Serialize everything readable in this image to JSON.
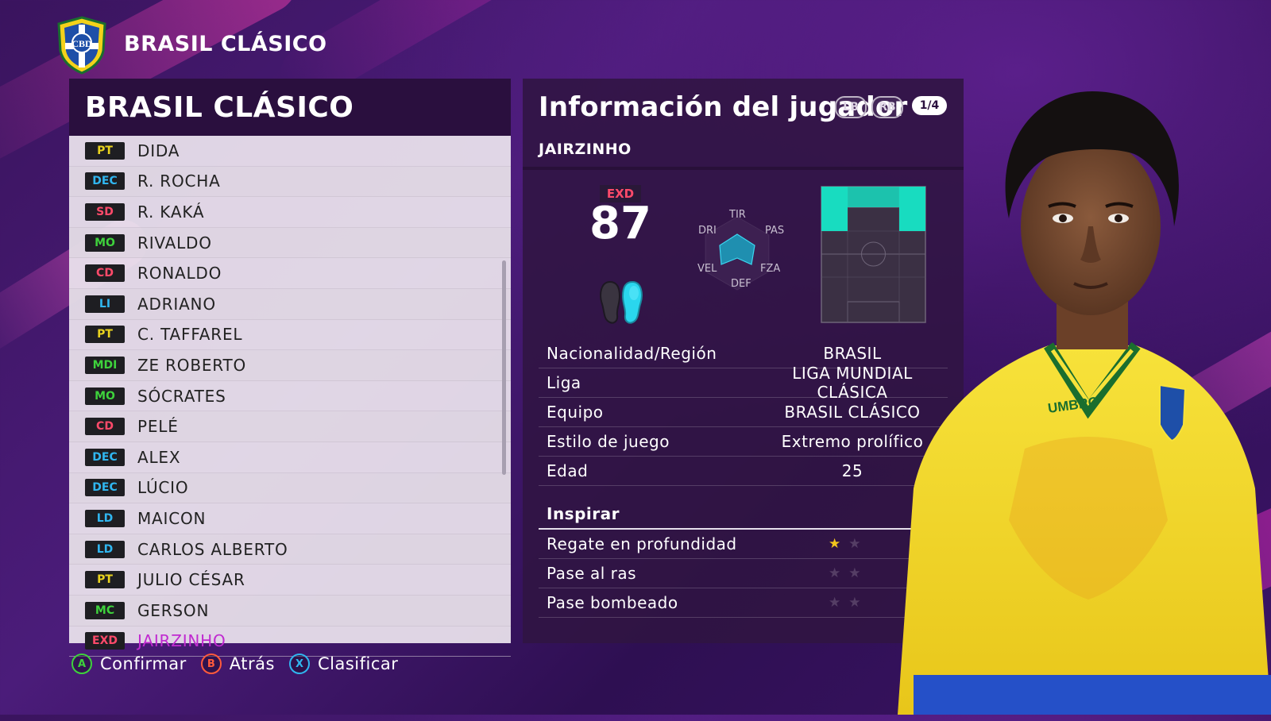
{
  "header": {
    "team_name": "BRASIL CLÁSICO",
    "crest_text": "CBD"
  },
  "roster": {
    "title": "BRASIL CLÁSICO",
    "players": [
      {
        "pos": "PT",
        "name": "DIDA"
      },
      {
        "pos": "DEC",
        "name": "R. ROCHA"
      },
      {
        "pos": "SD",
        "name": "R. KAKÁ"
      },
      {
        "pos": "MO",
        "name": "RIVALDO"
      },
      {
        "pos": "CD",
        "name": "RONALDO"
      },
      {
        "pos": "LI",
        "name": "ADRIANO"
      },
      {
        "pos": "PT",
        "name": "C. TAFFAREL"
      },
      {
        "pos": "MDI",
        "name": "ZE ROBERTO"
      },
      {
        "pos": "MO",
        "name": "SÓCRATES"
      },
      {
        "pos": "CD",
        "name": "PELÉ"
      },
      {
        "pos": "DEC",
        "name": "ALEX"
      },
      {
        "pos": "DEC",
        "name": "LÚCIO"
      },
      {
        "pos": "LD",
        "name": "MAICON"
      },
      {
        "pos": "LD",
        "name": "CARLOS ALBERTO"
      },
      {
        "pos": "PT",
        "name": "JULIO CÉSAR"
      },
      {
        "pos": "MC",
        "name": "GERSON"
      },
      {
        "pos": "EXD",
        "name": "JAIRZINHO"
      }
    ],
    "selected_index": 16
  },
  "buttons": [
    {
      "key": "A",
      "label": "Confirmar",
      "color": "#3ed23c"
    },
    {
      "key": "B",
      "label": "Atrás",
      "color": "#ff5a3c"
    },
    {
      "key": "X",
      "label": "Clasificar",
      "color": "#30b6f0"
    }
  ],
  "player_info": {
    "title": "Información del jugador",
    "lb": "LB",
    "rb": "RB",
    "page": "1/4",
    "name": "JAIRZINHO",
    "position": "EXD",
    "rating": "87",
    "radar_labels": {
      "tir": "TIR",
      "pas": "PAS",
      "fza": "FZA",
      "def": "DEF",
      "vel": "VEL",
      "dri": "DRI"
    },
    "details": [
      {
        "label": "Nacionalidad/Región",
        "value": "BRASIL"
      },
      {
        "label": "Liga",
        "value": "LIGA MUNDIAL CLÁSICA"
      },
      {
        "label": "Equipo",
        "value": "BRASIL CLÁSICO"
      },
      {
        "label": "Estilo de juego",
        "value": "Extremo prolífico"
      },
      {
        "label": "Edad",
        "value": "25"
      }
    ],
    "inspire": {
      "title": "Inspirar",
      "skills": [
        {
          "label": "Regate en profundidad",
          "stars": 1
        },
        {
          "label": "Pase al ras",
          "stars": 0
        },
        {
          "label": "Pase bombeado",
          "stars": 0
        }
      ]
    }
  },
  "colors": {
    "accent_selected": "#c02ad0",
    "gk": "#e8d21e",
    "def": "#30b6f0",
    "mid": "#3ed23c",
    "fwd": "#ff4a6a",
    "pitch_zone": "#18dcc0",
    "radar_fill": "#1f8fb0"
  }
}
